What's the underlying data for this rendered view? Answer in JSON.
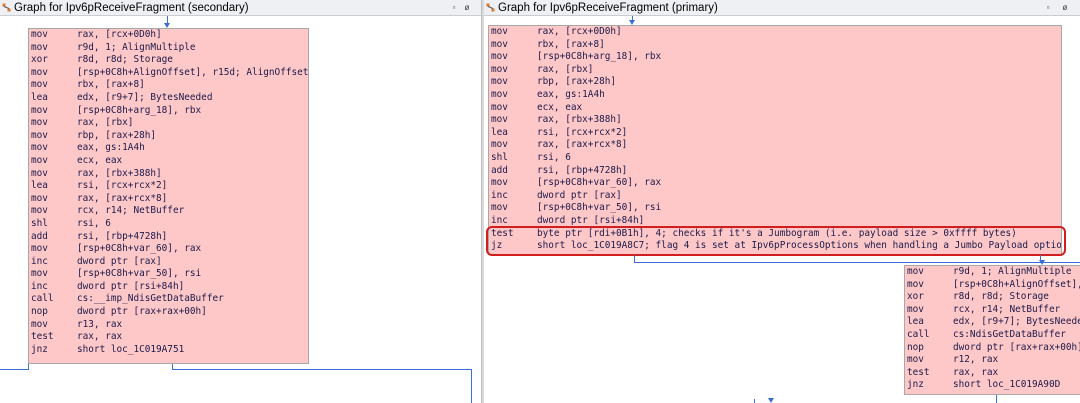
{
  "left_pane": {
    "title": "Graph for Ipv6pReceiveFragment (secondary)",
    "block": [
      {
        "m": "mov",
        "o": "rax, [rcx+0D0h]"
      },
      {
        "m": "mov",
        "o": "r9d, 1; AlignMultiple"
      },
      {
        "m": "xor",
        "o": "r8d, r8d; Storage"
      },
      {
        "m": "mov",
        "o": "[rsp+0C8h+AlignOffset], r15d; AlignOffset"
      },
      {
        "m": "mov",
        "o": "rbx, [rax+8]"
      },
      {
        "m": "lea",
        "o": "edx, [r9+7]; BytesNeeded"
      },
      {
        "m": "mov",
        "o": "[rsp+0C8h+arg_18], rbx"
      },
      {
        "m": "mov",
        "o": "rax, [rbx]"
      },
      {
        "m": "mov",
        "o": "rbp, [rax+28h]"
      },
      {
        "m": "mov",
        "o": "eax, gs:1A4h"
      },
      {
        "m": "mov",
        "o": "ecx, eax"
      },
      {
        "m": "mov",
        "o": "rax, [rbx+388h]"
      },
      {
        "m": "lea",
        "o": "rsi, [rcx+rcx*2]"
      },
      {
        "m": "mov",
        "o": "rax, [rax+rcx*8]"
      },
      {
        "m": "mov",
        "o": "rcx, r14; NetBuffer"
      },
      {
        "m": "shl",
        "o": "rsi, 6"
      },
      {
        "m": "add",
        "o": "rsi, [rbp+4728h]"
      },
      {
        "m": "mov",
        "o": "[rsp+0C8h+var_60], rax"
      },
      {
        "m": "inc",
        "o": "dword ptr [rax]"
      },
      {
        "m": "mov",
        "o": "[rsp+0C8h+var_50], rsi"
      },
      {
        "m": "inc",
        "o": "dword ptr [rsi+84h]"
      },
      {
        "m": "call",
        "o": "cs:__imp_NdisGetDataBuffer"
      },
      {
        "m": "nop",
        "o": "dword ptr [rax+rax+00h]"
      },
      {
        "m": "mov",
        "o": "r13, rax"
      },
      {
        "m": "test",
        "o": "rax, rax"
      },
      {
        "m": "jnz",
        "o": "short loc_1C019A751"
      }
    ]
  },
  "right_pane": {
    "title": "Graph for Ipv6pReceiveFragment (primary)",
    "block_main": [
      {
        "m": "mov",
        "o": "rax, [rcx+0D0h]"
      },
      {
        "m": "mov",
        "o": "rbx, [rax+8]"
      },
      {
        "m": "mov",
        "o": "[rsp+0C8h+arg_18], rbx"
      },
      {
        "m": "mov",
        "o": "rax, [rbx]"
      },
      {
        "m": "mov",
        "o": "rbp, [rax+28h]"
      },
      {
        "m": "mov",
        "o": "eax, gs:1A4h"
      },
      {
        "m": "mov",
        "o": "ecx, eax"
      },
      {
        "m": "mov",
        "o": "rax, [rbx+388h]"
      },
      {
        "m": "lea",
        "o": "rsi, [rcx+rcx*2]"
      },
      {
        "m": "mov",
        "o": "rax, [rax+rcx*8]"
      },
      {
        "m": "shl",
        "o": "rsi, 6"
      },
      {
        "m": "add",
        "o": "rsi, [rbp+4728h]"
      },
      {
        "m": "mov",
        "o": "[rsp+0C8h+var_60], rax"
      },
      {
        "m": "inc",
        "o": "dword ptr [rax]"
      },
      {
        "m": "mov",
        "o": "[rsp+0C8h+var_50], rsi"
      },
      {
        "m": "inc",
        "o": "dword ptr [rsi+84h]"
      },
      {
        "m": "test",
        "o": "byte ptr [rdi+0B1h], 4; checks if it's a Jumbogram (i.e. payload size > 0xffff bytes)"
      },
      {
        "m": "jz",
        "o": "short loc_1C019A8C7; flag 4 is set at Ipv6pProcessOptions when handling a Jumbo Payload option"
      }
    ],
    "block_sub": [
      {
        "m": "mov",
        "o": "r9d, 1; AlignMultiple"
      },
      {
        "m": "mov",
        "o": "[rsp+0C8h+AlignOffset],"
      },
      {
        "m": "xor",
        "o": "r8d, r8d; Storage"
      },
      {
        "m": "mov",
        "o": "rcx, r14; NetBuffer"
      },
      {
        "m": "lea",
        "o": "edx, [r9+7]; BytesNeede"
      },
      {
        "m": "call",
        "o": "cs:NdisGetDataBuffer"
      },
      {
        "m": "nop",
        "o": "dword ptr [rax+rax+00h]"
      },
      {
        "m": "mov",
        "o": "r12, rax"
      },
      {
        "m": "test",
        "o": "rax, rax"
      },
      {
        "m": "jnz",
        "o": "short loc_1C019A90D"
      }
    ]
  },
  "window_buttons": {
    "restore": "▫",
    "close": "ø"
  },
  "colors": {
    "block_bg": "#ffc8c8",
    "edge": "#3a6fd8",
    "highlight": "#d11f1f",
    "title_bg": "#eef0f4"
  }
}
